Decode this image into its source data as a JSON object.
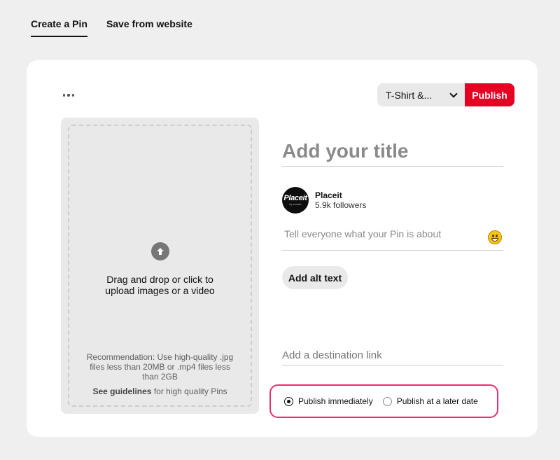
{
  "tabs": [
    {
      "label": "Create a Pin",
      "active": true
    },
    {
      "label": "Save from website",
      "active": false
    }
  ],
  "toolbar": {
    "more_icon": "more-horizontal-icon",
    "board_select_value": "T-Shirt &...",
    "publish_label": "Publish",
    "accent_color": "#e60023"
  },
  "upload": {
    "icon": "arrow-up-circle-icon",
    "text": "Drag and drop or click to upload images or a video",
    "recommendation": "Recommendation: Use high-quality .jpg files less than 20MB or .mp4 files less than 2GB",
    "guidelines_link": "See guidelines",
    "guidelines_rest": " for high quality Pins"
  },
  "form": {
    "title_placeholder": "Add your title",
    "profile": {
      "avatar_brand": "Placeit",
      "avatar_sub": "by envato",
      "name": "Placeit",
      "followers": "5.9k followers"
    },
    "description_placeholder": "Tell everyone what your Pin is about",
    "emoji_icon": "smiley-emoji-icon",
    "alt_text_label": "Add alt text",
    "link_placeholder": "Add a destination link"
  },
  "schedule": {
    "highlight_color": "#e4316b",
    "options": [
      {
        "label": "Publish immediately",
        "selected": true
      },
      {
        "label": "Publish at a later date",
        "selected": false
      }
    ]
  }
}
